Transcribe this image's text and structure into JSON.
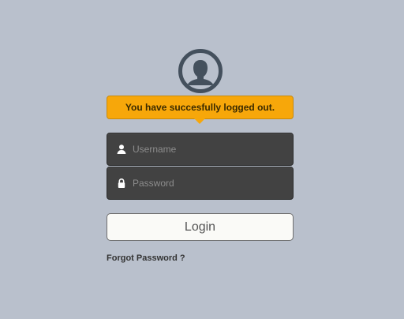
{
  "avatar": {
    "icon": "user-silhouette-icon"
  },
  "notice": {
    "message": "You have succesfully logged out.",
    "color": "#f7a70a"
  },
  "form": {
    "username": {
      "placeholder": "Username",
      "value": "",
      "icon": "user-icon"
    },
    "password": {
      "placeholder": "Password",
      "value": "",
      "icon": "lock-icon"
    },
    "login_label": "Login",
    "forgot_label": "Forgot Password ?"
  }
}
